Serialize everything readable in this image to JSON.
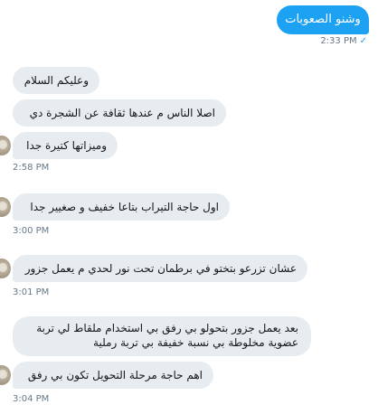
{
  "conversation": {
    "sent": {
      "text": "وشنو الصعوبات",
      "time": "2:33 PM",
      "status_icon": "✓"
    },
    "groups": [
      {
        "messages": [
          "وعليكم السلام",
          "اصلا الناس م عندها ثقافة عن الشجرة دي",
          "وميزاتها كتيرة جدا"
        ],
        "time": "2:58 PM"
      },
      {
        "messages": [
          "اول حاجة التيراب بتاعا خفيف و صغيير جدا"
        ],
        "time": "3:00 PM"
      },
      {
        "messages": [
          "عشان تزرعو بتختو في برطمان تحت نور لحدي م يعمل جزور"
        ],
        "time": "3:01 PM"
      },
      {
        "messages": [
          "بعد يعمل جزور بتحولو بي رفق بي استخدام ملقاط لي تربة\nعضوية مخلوطة بي نسبة خفيفة بي تربة رملية",
          "اهم حاجة مرحلة التحويل تكون بي رفق"
        ],
        "time": "3:04 PM"
      }
    ]
  },
  "colors": {
    "sent_bubble": "#1da1f2",
    "received_bubble": "#e6ecf0",
    "timestamp": "#657786"
  }
}
